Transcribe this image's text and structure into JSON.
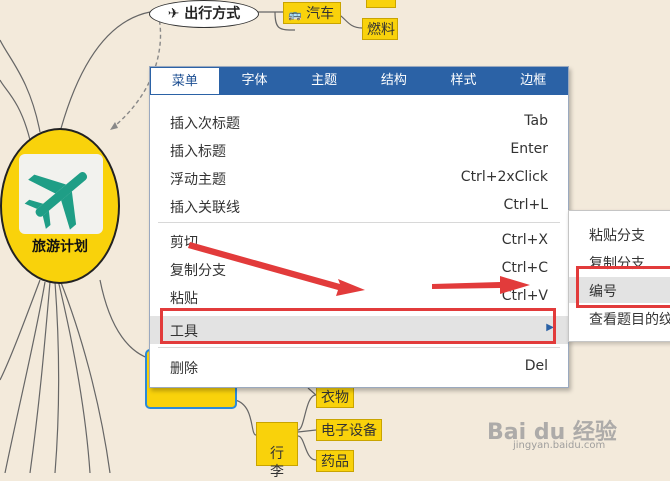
{
  "mindmap": {
    "center_label": "旅游计划",
    "travel_mode_label": "出行方式",
    "car_label": "汽车",
    "fuel_label": "燃料",
    "luggage_label": "行\n李",
    "clothes_label": "衣物",
    "electronics_label": "电子设备",
    "medicine_label": "药品",
    "colors": {
      "topic_fill": "#f9d20b",
      "background": "#f3eadb"
    }
  },
  "menu": {
    "tabs": [
      "菜单",
      "字体",
      "主题",
      "结构",
      "样式",
      "边框"
    ],
    "active_tab": "菜单",
    "items": [
      {
        "label": "插入次标题",
        "shortcut": "Tab"
      },
      {
        "label": "插入标题",
        "shortcut": "Enter"
      },
      {
        "label": "浮动主题",
        "shortcut": "Ctrl+2xClick"
      },
      {
        "label": "插入关联线",
        "shortcut": "Ctrl+L"
      },
      {
        "label": "剪切",
        "shortcut": "Ctrl+X"
      },
      {
        "label": "复制分支",
        "shortcut": "Ctrl+C"
      },
      {
        "label": "粘贴",
        "shortcut": "Ctrl+V"
      },
      {
        "label": "工具",
        "shortcut": ""
      },
      {
        "label": "删除",
        "shortcut": "Del"
      }
    ],
    "colors": {
      "tabbar": "#2b62a6"
    }
  },
  "submenu": {
    "items": [
      "粘贴分支",
      "复制分支",
      "编号",
      "查看题目的纹"
    ]
  },
  "annotations": {
    "highlight_color": "#e23b3b"
  },
  "watermark": {
    "brand": "Bai du 经验",
    "sub": "jingyan.baidu.com"
  }
}
